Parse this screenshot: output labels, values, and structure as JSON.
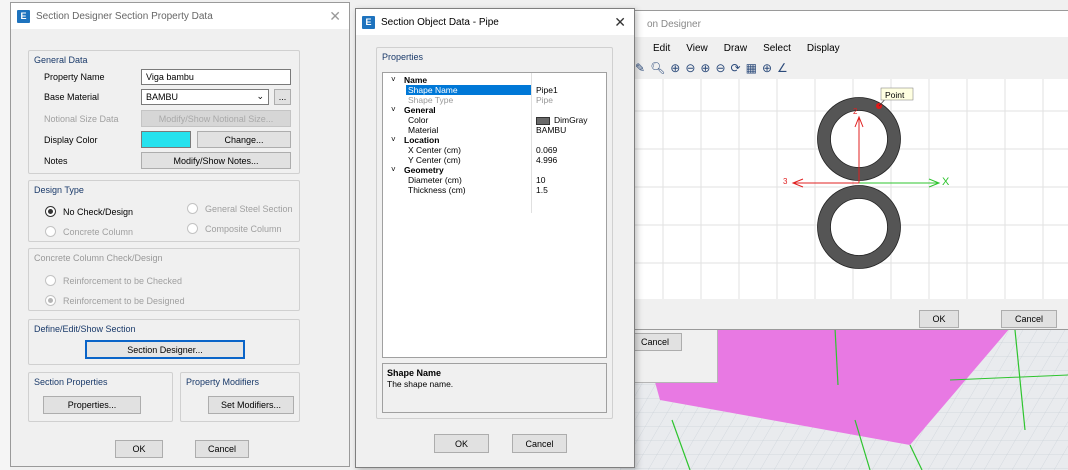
{
  "w1": {
    "title": "Section Designer Section Property Data",
    "general_data_title": "General Data",
    "property_name_label": "Property Name",
    "property_name_value": "Viga bambu",
    "base_material_label": "Base Material",
    "base_material_value": "BAMBU",
    "ellipsis": "...",
    "notional_label": "Notional Size Data",
    "notional_btn": "Modify/Show Notional Size...",
    "display_color_label": "Display Color",
    "display_color_value": "#25e2ee",
    "change_btn": "Change...",
    "notes_label": "Notes",
    "notes_btn": "Modify/Show Notes...",
    "design_type_title": "Design Type",
    "opt_nocheck": "No Check/Design",
    "opt_general_steel": "General Steel Section",
    "opt_concrete_col": "Concrete Column",
    "opt_composite_col": "Composite Column",
    "concrete_check_title": "Concrete Column Check/Design",
    "opt_reinf_checked": "Reinforcement to be Checked",
    "opt_reinf_designed": "Reinforcement to be Designed",
    "define_title": "Define/Edit/Show Section",
    "section_designer_btn": "Section Designer...",
    "section_props_title": "Section Properties",
    "properties_btn": "Properties...",
    "prop_mod_title": "Property Modifiers",
    "set_modifiers_btn": "Set Modifiers...",
    "ok": "OK",
    "cancel": "Cancel"
  },
  "w2": {
    "title": "Section Object Data - Pipe",
    "properties_title": "Properties",
    "rows": [
      {
        "type": "cat",
        "name": "Name"
      },
      {
        "type": "prop",
        "name": "Shape Name",
        "value": "Pipe1",
        "selected": true
      },
      {
        "type": "prop",
        "name": "Shape Type",
        "value": "Pipe",
        "dim": true
      },
      {
        "type": "cat",
        "name": "General"
      },
      {
        "type": "prop",
        "name": "Color",
        "value": "DimGray",
        "swatch": "#696969"
      },
      {
        "type": "prop",
        "name": "Material",
        "value": "BAMBU"
      },
      {
        "type": "cat",
        "name": "Location"
      },
      {
        "type": "prop",
        "name": "X Center (cm)",
        "value": "0.069"
      },
      {
        "type": "prop",
        "name": "Y Center (cm)",
        "value": "4.996"
      },
      {
        "type": "cat",
        "name": "Geometry"
      },
      {
        "type": "prop",
        "name": "Diameter (cm)",
        "value": "10"
      },
      {
        "type": "prop",
        "name": "Thickness (cm)",
        "value": "1.5"
      }
    ],
    "desc_title": "Shape Name",
    "desc_text": "The shape name.",
    "ok": "OK",
    "cancel": "Cancel"
  },
  "w3": {
    "title": "on Designer",
    "menu": [
      "Edit",
      "View",
      "Draw",
      "Select",
      "Display"
    ],
    "point_label": "Point",
    "axis_x": "X",
    "axis_2": "2",
    "axis_3": "3",
    "ok": "OK",
    "cancel": "Cancel"
  },
  "bg": {
    "cancel": "Cancel"
  }
}
